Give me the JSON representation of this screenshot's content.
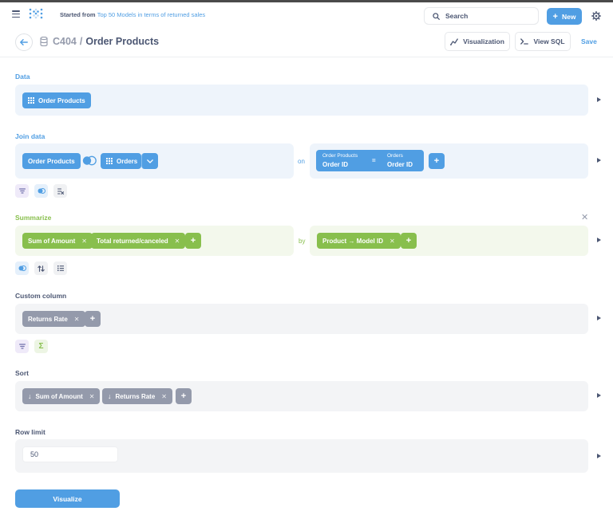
{
  "topbar": {
    "started_prefix": "Started from",
    "started_link": "Top 50 Models in terms of returned sales",
    "search_label": "Search",
    "new_label": "New"
  },
  "header": {
    "database": "C404",
    "separator": "/",
    "table": "Order Products",
    "visualization_label": "Visualization",
    "view_sql_label": "View SQL",
    "save_label": "Save"
  },
  "data_section": {
    "label": "Data",
    "table": "Order Products"
  },
  "join_section": {
    "label": "Join data",
    "left_table": "Order Products",
    "right_table": "Orders",
    "on_label": "on",
    "condition": {
      "left_table": "Order Products",
      "left_column": "Order ID",
      "operator": "=",
      "right_table": "Orders",
      "right_column": "Order ID"
    }
  },
  "summarize_section": {
    "label": "Summarize",
    "metrics": [
      "Sum of Amount",
      "Total returned/canceled"
    ],
    "by_label": "by",
    "breakouts": [
      "Product → Model ID"
    ]
  },
  "custom_column_section": {
    "label": "Custom column",
    "columns": [
      "Returns Rate"
    ]
  },
  "sort_section": {
    "label": "Sort",
    "items": [
      "Sum of Amount",
      "Returns Rate"
    ]
  },
  "row_limit_section": {
    "label": "Row limit",
    "value": "50"
  },
  "visualize_label": "Visualize",
  "colors": {
    "brand": "#509ee3",
    "summarize": "#88bf4d",
    "neutral": "#949aab",
    "text": "#4c5773"
  }
}
